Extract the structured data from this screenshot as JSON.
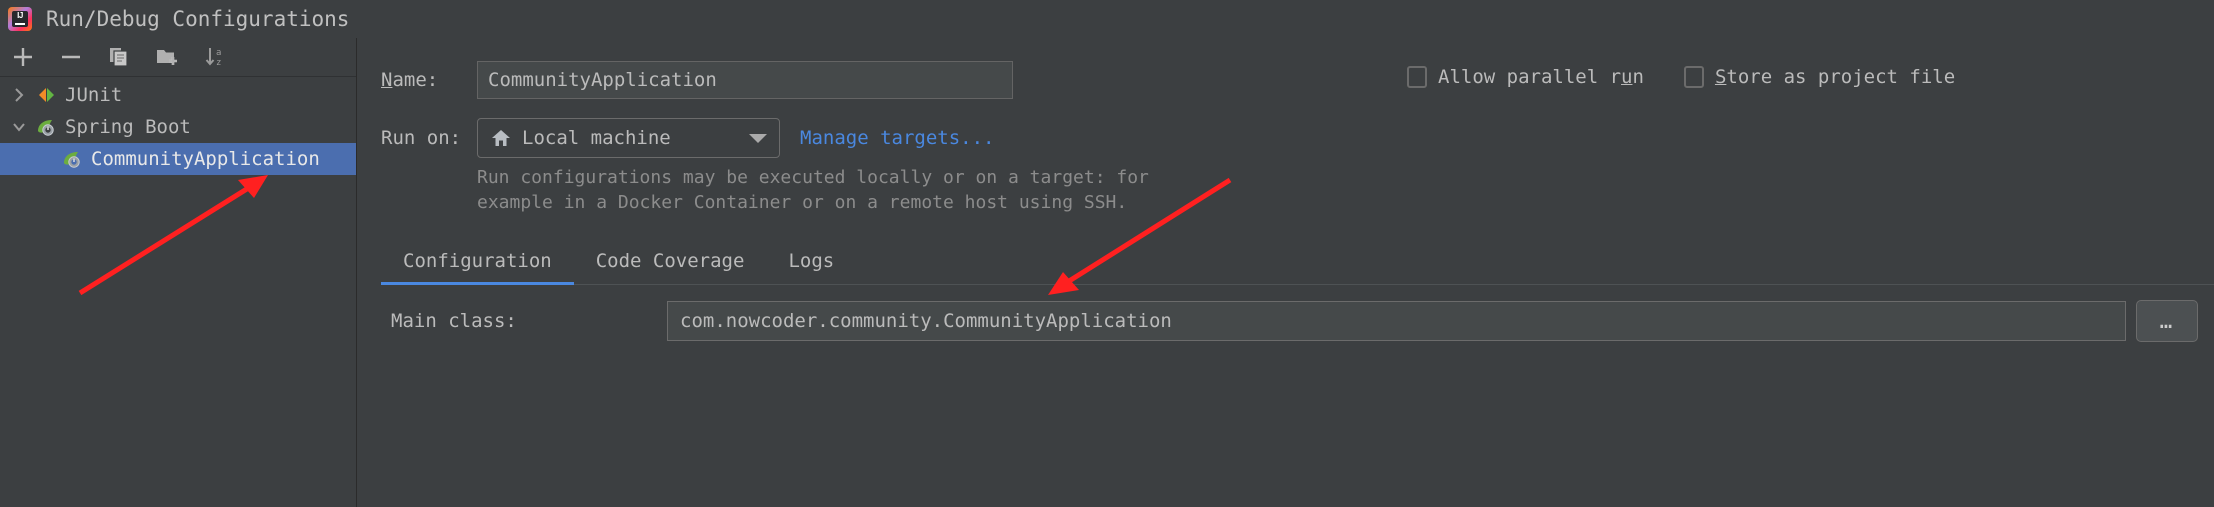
{
  "window": {
    "title": "Run/Debug Configurations",
    "app_icon": "intellij-idea-icon",
    "icon_text": "IJ"
  },
  "toolbar": {
    "items": [
      {
        "name": "add-configuration-button",
        "icon": "plus-icon",
        "label": "+"
      },
      {
        "name": "remove-configuration-button",
        "icon": "minus-icon",
        "label": "−"
      },
      {
        "name": "copy-configuration-button",
        "icon": "copy-icon",
        "label": "Copy"
      },
      {
        "name": "new-folder-button",
        "icon": "folder-add-icon",
        "label": "New Folder"
      },
      {
        "name": "sort-configurations-button",
        "icon": "sort-alphabetically-icon",
        "label": "Sort"
      }
    ]
  },
  "tree": {
    "items": [
      {
        "label": "JUnit",
        "icon": "junit-icon",
        "twisty": "›",
        "expanded": false,
        "selected": false,
        "level": 0
      },
      {
        "label": "Spring Boot",
        "icon": "spring-boot-icon",
        "twisty": "⌄",
        "expanded": true,
        "selected": false,
        "level": 0
      },
      {
        "label": "CommunityApplication",
        "icon": "spring-boot-icon",
        "twisty": "",
        "expanded": false,
        "selected": true,
        "level": 1
      }
    ]
  },
  "form": {
    "name_label": "Name:",
    "name_mnemonic": "N",
    "name_label_rest": "ame:",
    "name_value": "CommunityApplication",
    "checkboxes": [
      {
        "prefix": "Allow parallel r",
        "mnemonic": "u",
        "suffix": "n",
        "checked": false,
        "name": "allow-parallel-run"
      },
      {
        "prefix": "",
        "mnemonic": "S",
        "suffix": "tore as project file",
        "checked": false,
        "name": "store-as-project-file"
      }
    ],
    "run_on_label": "Run on:",
    "run_on_value": "Local machine",
    "run_on_icon": "home-icon",
    "manage_targets_link": "Manage targets...",
    "hint_line1": "Run configurations may be executed locally or on a target: for",
    "hint_line2": "example in a Docker Container or on a remote host using SSH."
  },
  "tabs": {
    "items": [
      {
        "label": "Configuration",
        "active": true
      },
      {
        "label": "Code Coverage",
        "active": false
      },
      {
        "label": "Logs",
        "active": false
      }
    ]
  },
  "main_class": {
    "label": "Main class:",
    "value": "com.nowcoder.community.CommunityApplication",
    "browse_button": "…"
  },
  "colors": {
    "background": "#3c3f41",
    "selection": "#4b6eaf",
    "link": "#4a88e0",
    "accent": "#4a88e0",
    "annotation_arrow": "#ff2020",
    "field_background": "#45494a",
    "text": "#bbbbbb",
    "hint_text": "#8c8c8c"
  },
  "annotations": [
    {
      "name": "arrow-to-selected-config",
      "color": "#ff2020"
    },
    {
      "name": "arrow-to-main-class-field",
      "color": "#ff2020"
    }
  ]
}
